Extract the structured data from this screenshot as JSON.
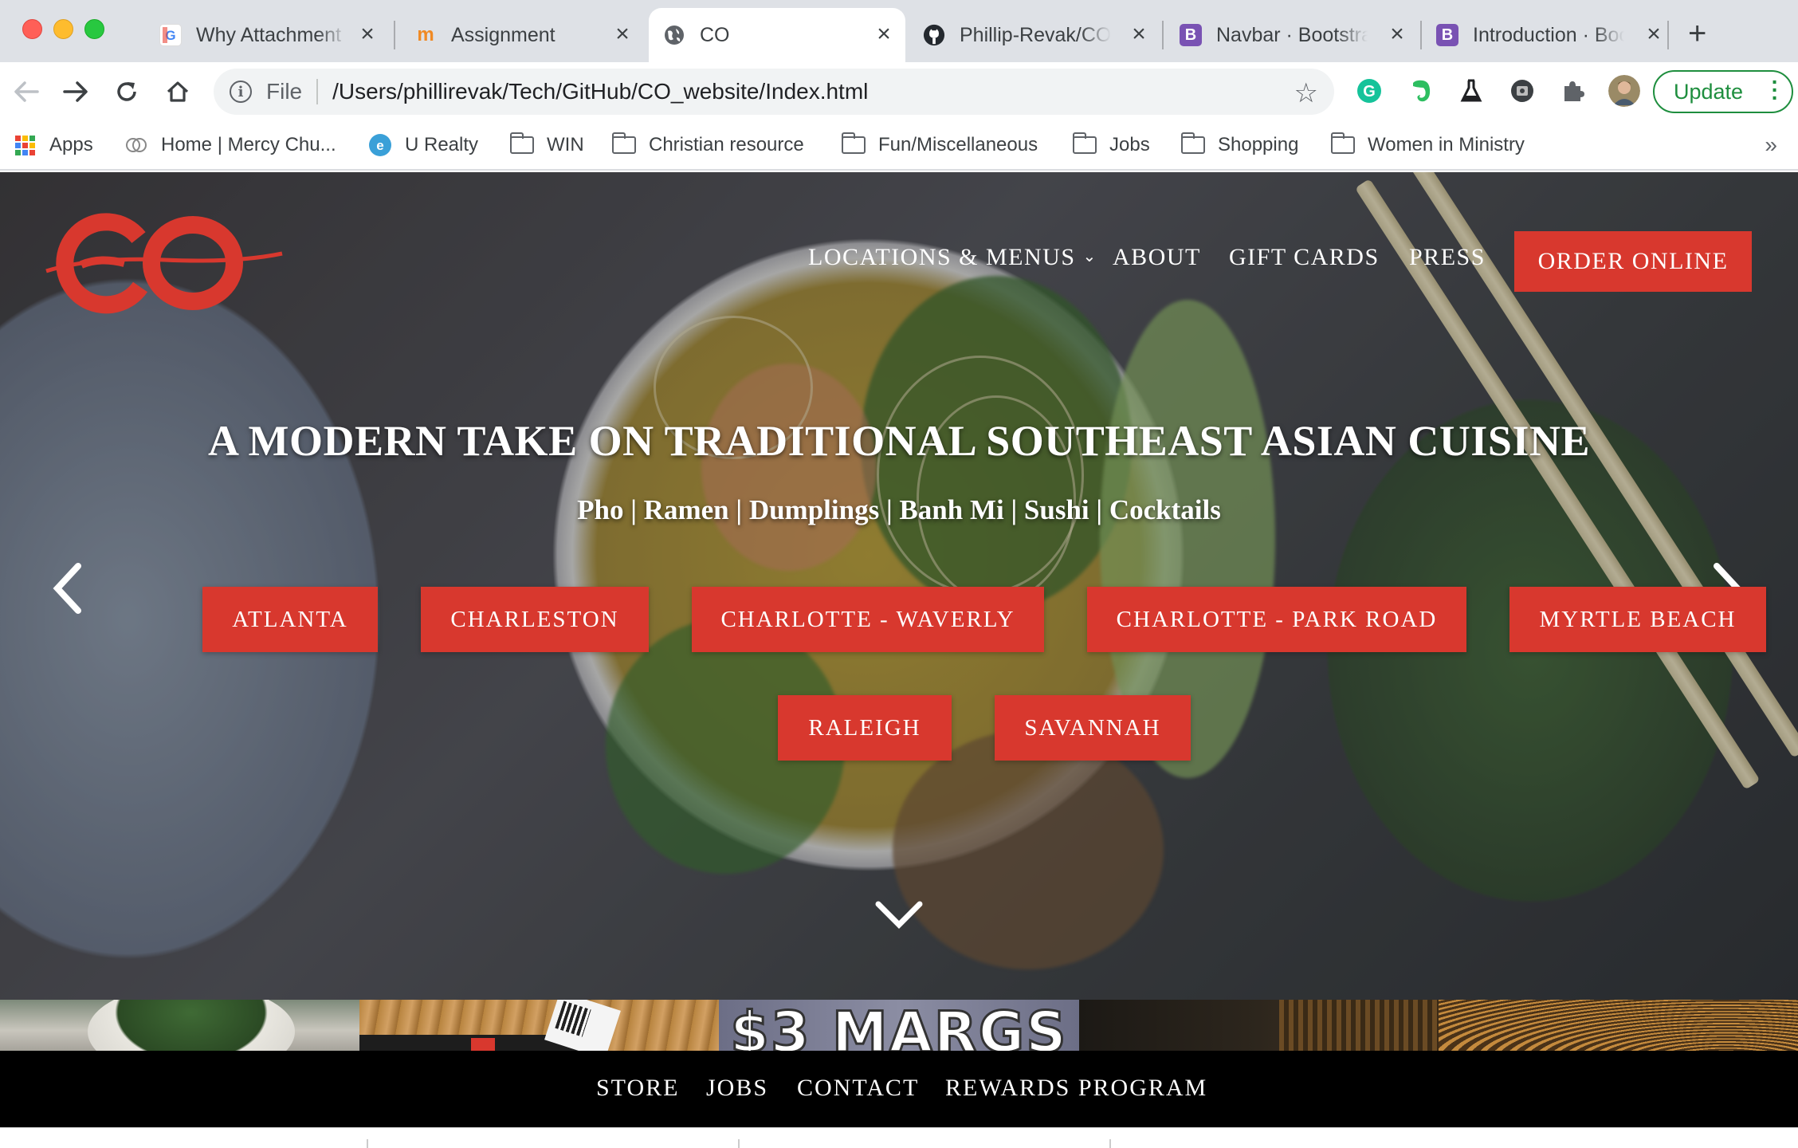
{
  "browser": {
    "tabs": [
      {
        "title": "Why Attachment",
        "favicon": "G",
        "favicon_color": "#ffffff",
        "active": false
      },
      {
        "title": "Assignment",
        "favicon": "m",
        "favicon_color": "#f08a24",
        "active": false
      },
      {
        "title": "CO",
        "favicon": "globe",
        "active": true
      },
      {
        "title": "Phillip-Revak/CO",
        "favicon": "github",
        "active": false
      },
      {
        "title": "Navbar · Bootstrap",
        "favicon": "B",
        "favicon_color": "#7952b3",
        "active": false
      },
      {
        "title": "Introduction · Bootstrap",
        "favicon": "B",
        "favicon_color": "#7952b3",
        "active": false
      }
    ],
    "address": {
      "scheme_label": "File",
      "url": "/Users/phillirevak/Tech/GitHub/CO_website/Index.html"
    },
    "update_label": "Update",
    "bookmarks": [
      {
        "label": "Apps",
        "icon": "apps-grid-icon"
      },
      {
        "label": "Home | Mercy Chu...",
        "icon": "mercy-logo-icon"
      },
      {
        "label": "U Realty",
        "icon": "u-realty-icon"
      },
      {
        "label": "WIN",
        "icon": "folder-icon"
      },
      {
        "label": "Christian resource",
        "icon": "folder-icon"
      },
      {
        "label": "Fun/Miscellaneous",
        "icon": "folder-icon"
      },
      {
        "label": "Jobs",
        "icon": "folder-icon"
      },
      {
        "label": "Shopping",
        "icon": "folder-icon"
      },
      {
        "label": "Women in Ministry",
        "icon": "folder-icon"
      }
    ],
    "bookmarks_overflow": "»"
  },
  "site": {
    "brand_color": "#d8382e",
    "logo_text": "CO",
    "nav": {
      "locations_menus": "LOCATIONS & MENUS",
      "about": "ABOUT",
      "gift_cards": "GIFT CARDS",
      "press": "PRESS",
      "order_online": "ORDER ONLINE"
    },
    "hero": {
      "headline": "A MODERN TAKE ON TRADITIONAL SOUTHEAST ASIAN CUISINE",
      "subhead": "Pho | Ramen | Dumplings | Banh Mi | Sushi | Cocktails",
      "locations": [
        "ATLANTA",
        "CHARLESTON",
        "CHARLOTTE - WAVERLY",
        "CHARLOTTE - PARK ROAD",
        "MYRTLE BEACH",
        "RALEIGH",
        "SAVANNAH"
      ]
    },
    "promo": {
      "margs_text": "$3 MARGS"
    },
    "footer_nav": {
      "store": "STORE",
      "jobs": "JOBS",
      "contact": "CONTACT",
      "rewards": "REWARDS PROGRAM"
    }
  }
}
